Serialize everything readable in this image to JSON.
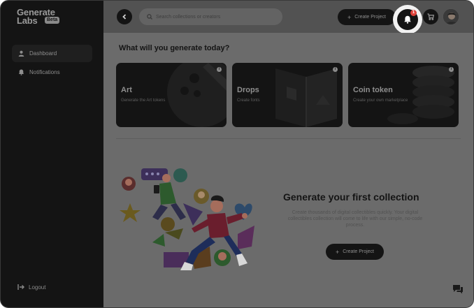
{
  "brand": {
    "line1": "Generate",
    "line2": "Labs",
    "badge": "Beta"
  },
  "sidebar": {
    "items": [
      {
        "label": "Dashboard",
        "icon": "user-icon",
        "active": true
      },
      {
        "label": "Notifications",
        "icon": "bell-icon",
        "active": false
      }
    ],
    "logout_label": "Logout"
  },
  "header": {
    "search_placeholder": "Search collections or creators",
    "create_label": "Create Project",
    "notifications_count": "1"
  },
  "main": {
    "title": "What will you generate today?",
    "cards": [
      {
        "title": "Art",
        "subtitle": "Generate the Art tokens",
        "info": "i"
      },
      {
        "title": "Drops",
        "subtitle": "Create fonts",
        "info": "i"
      },
      {
        "title": "Coin token",
        "subtitle": "Create your own marketplace",
        "info": "i"
      }
    ],
    "hero": {
      "title": "Generate your first collection",
      "description": "Create thousands of digital collectibles quickly. Your digital collectibles collection will come to life with our simple, no-code process.",
      "button_label": "Create Project"
    }
  },
  "colors": {
    "accent": "#141414",
    "badge": "#e0423a",
    "overlay": "#6b6b6b"
  }
}
